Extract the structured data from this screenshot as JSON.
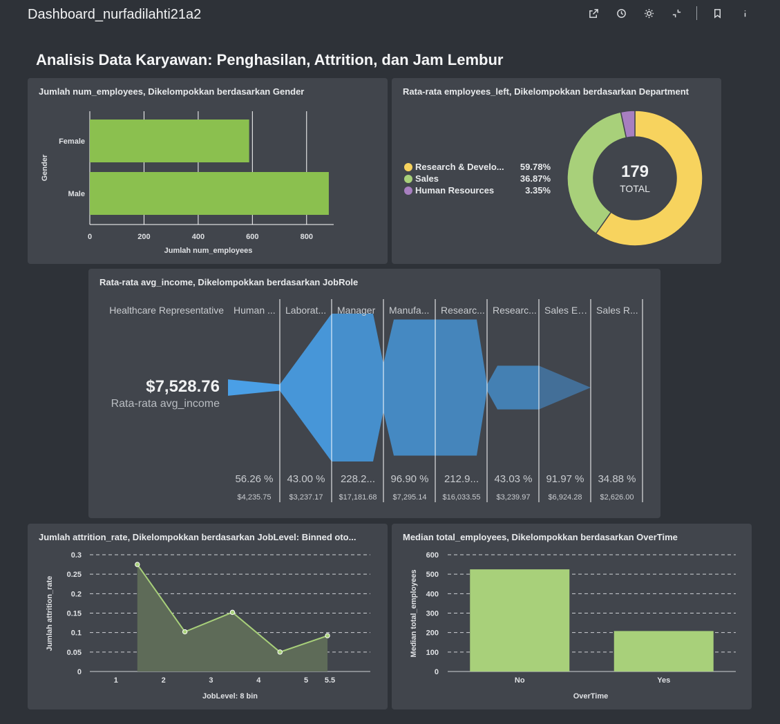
{
  "app": {
    "title": "Dashboard_nurfadilahti21a2"
  },
  "toolbar": {
    "icons": [
      "external-link-icon",
      "clock-icon",
      "brightness-icon",
      "collapse-icon",
      "bookmark-icon",
      "info-icon"
    ]
  },
  "dashboard": {
    "title": "Analisis Data Karyawan: Penghasilan, Attrition, dan Jam Lembur"
  },
  "colors": {
    "green": "#8bc04f",
    "light_green": "#a8d07a",
    "yellow": "#f7d35e",
    "purple": "#a77fc0",
    "blue": "#4a9fe6"
  },
  "cards": {
    "gender": {
      "title": "Jumlah num_employees, Dikelompokkan berdasarkan Gender"
    },
    "dept": {
      "title": "Rata-rata employees_left, Dikelompokkan berdasarkan Department",
      "total_value": "179",
      "total_label": "TOTAL"
    },
    "jobrole": {
      "title": "Rata-rata avg_income, Dikelompokkan berdasarkan JobRole",
      "kpi_value": "$7,528.76",
      "kpi_label": "Rata-rata avg_income"
    },
    "joblevel": {
      "title": "Jumlah attrition_rate, Dikelompokkan berdasarkan JobLevel: Binned oto..."
    },
    "overtime": {
      "title": "Median total_employees, Dikelompokkan berdasarkan OverTime"
    }
  },
  "chart_data": [
    {
      "type": "bar",
      "orientation": "horizontal",
      "categories": [
        "Female",
        "Male"
      ],
      "values": [
        588,
        882
      ],
      "xlabel": "Jumlah num_employees",
      "ylabel": "Gender",
      "xlim": [
        0,
        900
      ],
      "xticks": [
        "0",
        "200",
        "400",
        "600",
        "800"
      ],
      "grid": true
    },
    {
      "type": "pie",
      "donut": true,
      "categories": [
        "Research & Develo...",
        "Sales",
        "Human Resources"
      ],
      "values": [
        59.78,
        36.87,
        3.35
      ],
      "labels": [
        "59.78%",
        "36.87%",
        "3.35%"
      ],
      "colors": [
        "#f7d35e",
        "#a8d07a",
        "#a77fc0"
      ],
      "legend": "left"
    },
    {
      "type": "funnel",
      "categories": [
        "Healthcare Representative",
        "Human ...",
        "Laborat...",
        "Manager",
        "Manufa...",
        "Researc...",
        "Researc...",
        "Sales Ex...",
        "Sales R..."
      ],
      "values": [
        7528.76,
        4235.75,
        3237.17,
        17181.68,
        7295.14,
        16033.55,
        3239.97,
        6924.28,
        2626.0
      ],
      "value_labels": [
        "$4,235.75",
        "$3,237.17",
        "$17,181.68",
        "$7,295.14",
        "$16,033.55",
        "$3,239.97",
        "$6,924.28",
        "$2,626.00"
      ],
      "percent_labels": [
        "56.26 %",
        "43.00 %",
        "228.2...",
        "96.90 %",
        "212.9...",
        "43.03 %",
        "91.97 %",
        "34.88 %"
      ]
    },
    {
      "type": "area",
      "x": [
        1.45,
        2.45,
        3.45,
        4.45,
        5.45
      ],
      "y": [
        0.275,
        0.102,
        0.152,
        0.05,
        0.092
      ],
      "xticks": [
        "1",
        "2",
        "3",
        "4",
        "5",
        "5.5"
      ],
      "yticks": [
        "0",
        "0.05",
        "0.1",
        "0.15",
        "0.2",
        "0.25",
        "0.3"
      ],
      "xlim": [
        0.45,
        6.35
      ],
      "ylim": [
        0,
        0.3
      ],
      "xlabel": "JobLevel: 8 bin",
      "ylabel": "Jumlah attrition_rate",
      "grid": true
    },
    {
      "type": "bar",
      "categories": [
        "No",
        "Yes"
      ],
      "values": [
        525,
        208
      ],
      "xlabel": "OverTime",
      "ylabel": "Median total_employees",
      "ylim": [
        0,
        600
      ],
      "yticks": [
        "0",
        "100",
        "200",
        "300",
        "400",
        "500",
        "600"
      ],
      "grid": true
    }
  ]
}
